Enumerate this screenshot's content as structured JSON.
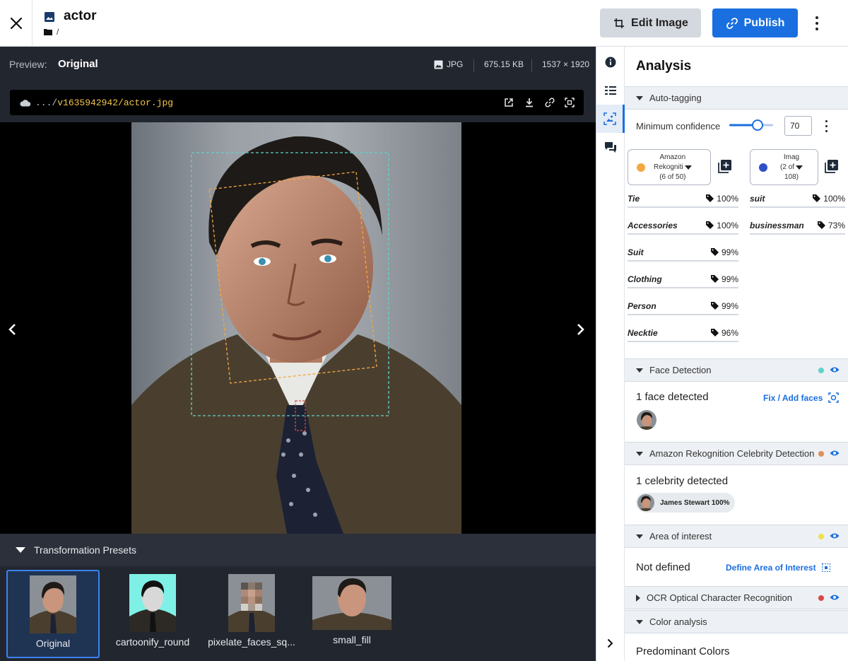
{
  "header": {
    "title": "actor",
    "folder_path": "/",
    "edit_label": "Edit Image",
    "publish_label": "Publish"
  },
  "preview": {
    "label": "Preview:",
    "mode": "Original",
    "format": "JPG",
    "file_size": "675.15 KB",
    "dimensions": "1537 × 1920",
    "url_prefix": ".../",
    "url_path": "v1635942942/actor.jpg"
  },
  "presets": {
    "title": "Transformation Presets",
    "items": [
      {
        "label": "Original",
        "selected": true
      },
      {
        "label": "cartoonify_round",
        "selected": false
      },
      {
        "label": "pixelate_faces_sq...",
        "selected": false
      },
      {
        "label": "small_fill",
        "selected": false
      }
    ]
  },
  "panel": {
    "title": "Analysis",
    "autotag": {
      "title": "Auto-tagging",
      "confidence_label": "Minimum confidence",
      "confidence_value": "70",
      "sources": [
        {
          "line1": "Amazon",
          "line2": "Rekogniti",
          "line3": "(6 of 50)",
          "color": "#f5a742"
        },
        {
          "line1": "Imag",
          "line2": "(2 of",
          "line3": "108)",
          "color": "#2f4fc9"
        }
      ],
      "left_tags": [
        {
          "name": "Tie",
          "value": "100%"
        },
        {
          "name": "Accessories",
          "value": "100%"
        },
        {
          "name": "Suit",
          "value": "99%"
        },
        {
          "name": "Clothing",
          "value": "99%"
        },
        {
          "name": "Person",
          "value": "99%"
        },
        {
          "name": "Necktie",
          "value": "96%"
        }
      ],
      "right_tags": [
        {
          "name": "suit",
          "value": "100%"
        },
        {
          "name": "businessman",
          "value": "73%"
        }
      ]
    },
    "face": {
      "title": "Face Detection",
      "color": "#5fd3c9",
      "summary": "1 face detected",
      "link": "Fix / Add faces"
    },
    "celebrity": {
      "title": "Amazon Rekognition Celebrity Detection",
      "color": "#e0905a",
      "summary": "1 celebrity detected",
      "chip": "James Stewart 100%"
    },
    "aoi": {
      "title": "Area of interest",
      "color": "#f0e04a",
      "summary": "Not defined",
      "link": "Define Area of Interest"
    },
    "ocr": {
      "title": "OCR Optical Character Recognition",
      "color": "#d94848"
    },
    "color": {
      "title": "Color analysis",
      "subtitle": "Predominant Colors"
    }
  }
}
